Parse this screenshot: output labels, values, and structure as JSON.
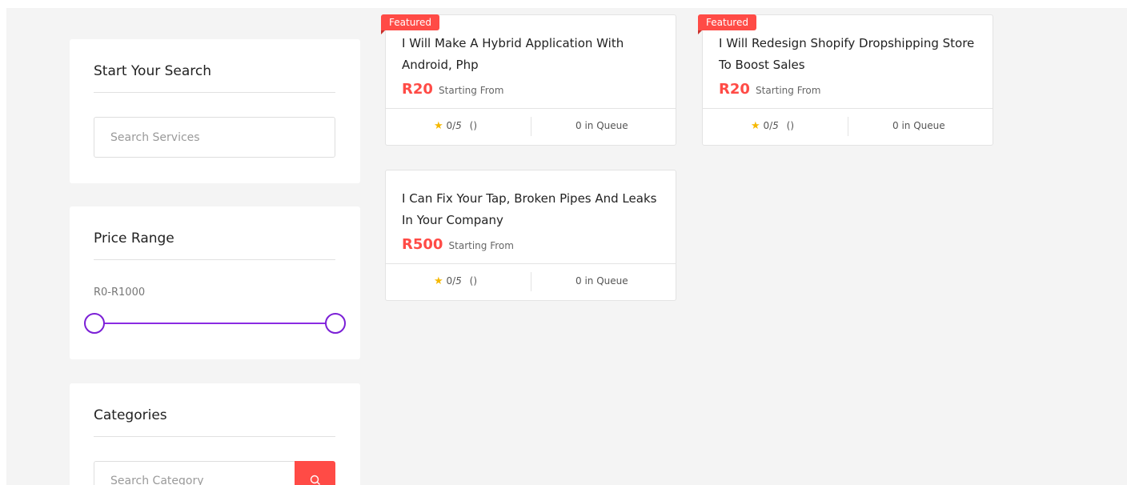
{
  "sidebar": {
    "search": {
      "title": "Start Your Search",
      "placeholder": "Search Services"
    },
    "price": {
      "title": "Price Range",
      "range_text": "R0-R1000",
      "min_value": 0,
      "max_value": 1000
    },
    "categories": {
      "title": "Categories",
      "placeholder": "Search Category",
      "button_icon": "search-icon"
    }
  },
  "services": [
    {
      "featured": true,
      "badge": "Featured",
      "title": "I Will Make A Hybrid Application With Android, Php",
      "price": "R20",
      "price_label": "Starting From",
      "rating_value": "0",
      "rating_max": "5",
      "reviews": "()",
      "queue": "0 in Queue"
    },
    {
      "featured": true,
      "badge": "Featured",
      "title": "I Will Redesign Shopify Dropshipping Store To Boost Sales",
      "price": "R20",
      "price_label": "Starting From",
      "rating_value": "0",
      "rating_max": "5",
      "reviews": "()",
      "queue": "0 in Queue"
    },
    {
      "featured": false,
      "badge": "",
      "title": "I Can Fix Your Tap, Broken Pipes And Leaks In Your Company",
      "price": "R500",
      "price_label": "Starting From",
      "rating_value": "0",
      "rating_max": "5",
      "reviews": "()",
      "queue": "0 in Queue"
    }
  ],
  "colors": {
    "accent": "#ff4b46",
    "slider": "#8a2be2",
    "star": "#f5b800"
  }
}
